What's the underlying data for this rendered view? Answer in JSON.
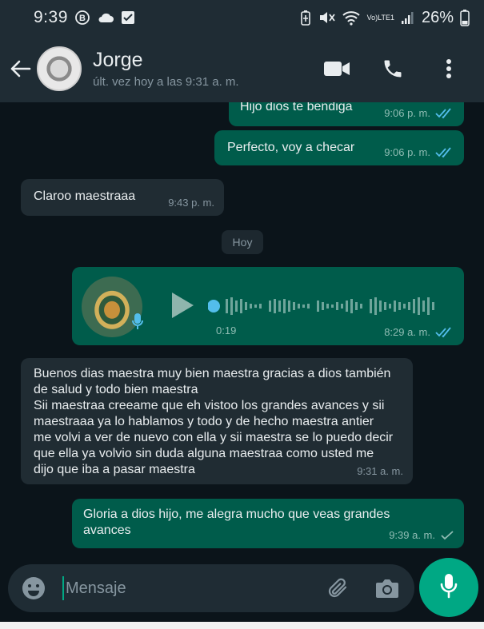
{
  "status_bar": {
    "time": "9:39",
    "network_top": "Vo)",
    "network_bottom": "LTE1",
    "battery": "26%"
  },
  "header": {
    "contact_name": "Jorge",
    "last_seen": "últ. vez hoy a las 9:31 a. m."
  },
  "messages": [
    {
      "type": "out",
      "text": "Hijo dios te bendiga",
      "time": "9:06 p. m.",
      "status": "read"
    },
    {
      "type": "out",
      "text": "Perfecto, voy a checar",
      "time": "9:06 p. m.",
      "status": "read"
    },
    {
      "type": "in",
      "text": "Claroo maestraaa",
      "time": "9:43 p. m."
    },
    {
      "type": "out",
      "voice_duration": "0:19",
      "time": "8:29 a. m.",
      "status": "read"
    },
    {
      "type": "in",
      "text": "Buenos dias maestra muy bien maestra gracias a dios también de salud y todo bien maestra\nSii maestraa creeame que eh vistoo los grandes avances y sii maestraaa ya lo hablamos y todo y de hecho maestra antier me volvi a ver de nuevo con ella y sii maestra se lo puedo decir que ella ya volvio sin duda alguna maestraa como usted me dijo que iba a pasar maestra",
      "time": "9:31 a. m."
    },
    {
      "type": "out",
      "text": "Gloria a dios hijo, me alegra mucho que veas grandes avances",
      "time": "9:39 a. m.",
      "status": "sent"
    }
  ],
  "day_separator": "Hoy",
  "input": {
    "placeholder": "Mensaje"
  },
  "colors": {
    "outgoing_bubble": "#005c4b",
    "incoming_bubble": "#202c33",
    "accent": "#00a884",
    "read_tick": "#53bdeb"
  },
  "icons": [
    "back-arrow-icon",
    "video-call-icon",
    "phone-icon",
    "more-options-icon",
    "play-icon",
    "mic-icon",
    "emoji-icon",
    "attach-icon",
    "camera-icon"
  ]
}
